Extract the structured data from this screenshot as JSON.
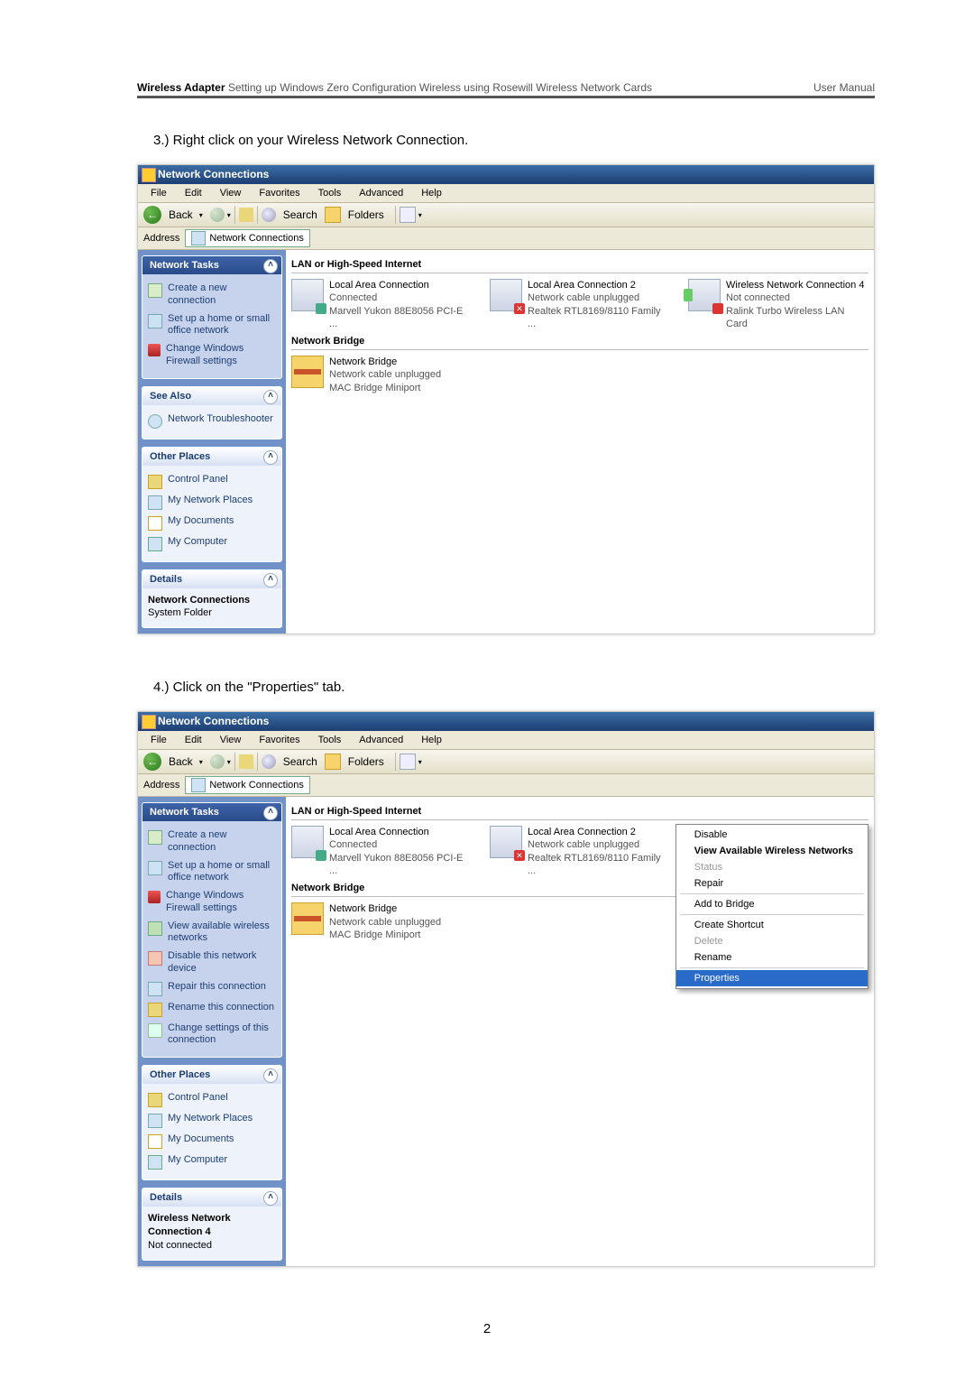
{
  "doc": {
    "header_bold": "Wireless Adapter",
    "header_rest": " Setting up Windows Zero Configuration Wireless using Rosewill Wireless Network Cards",
    "header_right": "User Manual",
    "step3": "3.)  Right click on your Wireless Network Connection.",
    "step4": "4.)  Click on the \"Properties\" tab.",
    "page_num": "2"
  },
  "win": {
    "title": "Network Connections",
    "menu": [
      "File",
      "Edit",
      "View",
      "Favorites",
      "Tools",
      "Advanced",
      "Help"
    ],
    "tb_back": "Back",
    "tb_search": "Search",
    "tb_folders": "Folders",
    "addr_label": "Address",
    "addr_value": "Network Connections"
  },
  "side1": {
    "tasks_title": "Network Tasks",
    "tasks": [
      "Create a new connection",
      "Set up a home or small office network",
      "Change Windows Firewall settings"
    ],
    "seealso_title": "See Also",
    "seealso": [
      "Network Troubleshooter"
    ],
    "other_title": "Other Places",
    "other": [
      "Control Panel",
      "My Network Places",
      "My Documents",
      "My Computer"
    ],
    "details_title": "Details",
    "details_name": "Network Connections",
    "details_type": "System Folder"
  },
  "side2": {
    "tasks_title": "Network Tasks",
    "tasks": [
      "Create a new connection",
      "Set up a home or small office network",
      "Change Windows Firewall settings",
      "View available wireless networks",
      "Disable this network device",
      "Repair this connection",
      "Rename this connection",
      "Change settings of this connection"
    ],
    "other_title": "Other Places",
    "other": [
      "Control Panel",
      "My Network Places",
      "My Documents",
      "My Computer"
    ],
    "details_title": "Details",
    "details_name": "Wireless Network Connection 4",
    "details_type": "Not connected"
  },
  "content": {
    "grp1": "LAN or High-Speed Internet",
    "grp2": "Network Bridge",
    "lan1": {
      "t": "Local Area Connection",
      "s1": "Connected",
      "s2": "Marvell Yukon 88E8056 PCI-E ..."
    },
    "lan2": {
      "t": "Local Area Connection 2",
      "s1": "Network cable unplugged",
      "s2": "Realtek RTL8169/8110 Family ..."
    },
    "wlan": {
      "t": "Wireless Network Connection 4",
      "s1": "Not connected",
      "s2": "Ralink Turbo Wireless LAN Card"
    },
    "bridge": {
      "t": "Network Bridge",
      "s1": "Network cable unplugged",
      "s2": "MAC Bridge Miniport"
    }
  },
  "ctx": {
    "items": [
      {
        "label": "Disable",
        "b": false
      },
      {
        "label": "View Available Wireless Networks",
        "b": true
      },
      {
        "label": "Status",
        "dis": true
      },
      {
        "label": "Repair",
        "b": false
      },
      {
        "sep": true
      },
      {
        "label": "Add to Bridge",
        "b": false
      },
      {
        "sep": true
      },
      {
        "label": "Create Shortcut",
        "b": false
      },
      {
        "label": "Delete",
        "dis": true
      },
      {
        "label": "Rename",
        "b": false
      },
      {
        "sep": true
      },
      {
        "label": "Properties",
        "hi": true
      }
    ]
  }
}
